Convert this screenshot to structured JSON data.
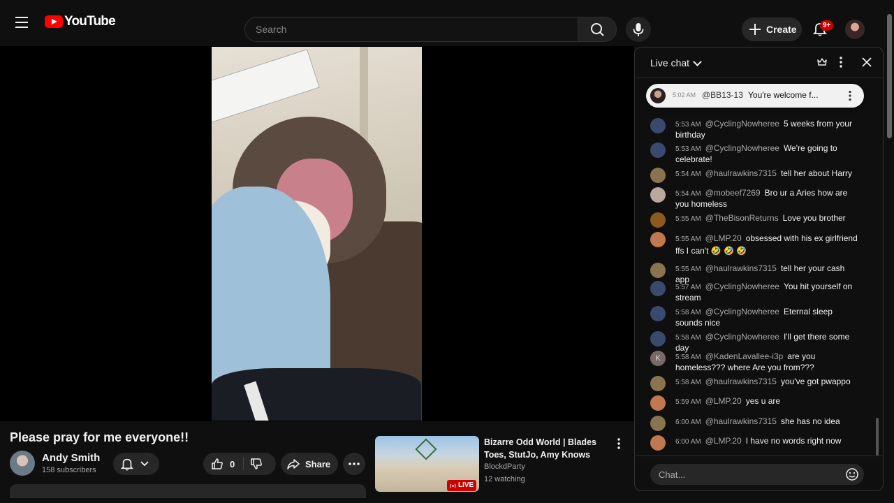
{
  "header": {
    "logo_text": "YouTube",
    "search_placeholder": "Search",
    "create_label": "Create",
    "notification_count": "9+"
  },
  "video": {
    "title": "Please pray for me everyone!!",
    "channel_name": "Andy Smith",
    "subscribers": "158 subscribers",
    "likes": "0",
    "share_label": "Share"
  },
  "suggested": {
    "title": "Bizarre Odd World | Blades Toes, StutJo, Amy Knows",
    "channel": "BlockdParty",
    "watching": "12 watching",
    "live_label": "LIVE"
  },
  "chat": {
    "title": "Live chat",
    "input_placeholder": "Chat...",
    "pinned": {
      "time": "5:02 AM",
      "author": "@BB13-13",
      "message": "You're welcome f..."
    },
    "messages": [
      {
        "time": "5:53 AM",
        "author": "@CyclingNowheree",
        "text": "5 weeks from your birthday",
        "avatar_color": "#3a4a6e"
      },
      {
        "time": "5:53 AM",
        "author": "@CyclingNowheree",
        "text": "We're going to celebrate!",
        "avatar_color": "#3a4a6e"
      },
      {
        "time": "5:54 AM",
        "author": "@haulrawkins7315",
        "text": "tell her about Harry",
        "avatar_color": "#8a7450"
      },
      {
        "time": "5:54 AM",
        "author": "@mobeef7269",
        "text": "Bro ur a Aries how are you homeless",
        "avatar_color": "#b9a8a0"
      },
      {
        "time": "5:55 AM",
        "author": "@TheBisonReturns",
        "text": "Love you brother",
        "avatar_color": "#8a5a20"
      },
      {
        "time": "5:55 AM",
        "author": "@LMP.20",
        "text": "obsessed with his ex girlfriend ffs I can't 🤣 🤣 🤣",
        "avatar_color": "#c07850"
      },
      {
        "time": "5:55 AM",
        "author": "@haulrawkins7315",
        "text": "tell her your cash app",
        "avatar_color": "#8a7450"
      },
      {
        "time": "5:57 AM",
        "author": "@CyclingNowheree",
        "text": "You hit yourself on stream",
        "avatar_color": "#3a4a6e"
      },
      {
        "time": "5:58 AM",
        "author": "@CyclingNowheree",
        "text": "Eternal sleep sounds nice",
        "avatar_color": "#3a4a6e"
      },
      {
        "time": "5:58 AM",
        "author": "@CyclingNowheree",
        "text": "I'll get there some day",
        "avatar_color": "#3a4a6e"
      },
      {
        "time": "5:58 AM",
        "author": "@KadenLavallee-i3p",
        "text": "are you homeless??? where Are you from???",
        "avatar_color": "#7a6a66",
        "avatar_letter": "K"
      },
      {
        "time": "5:58 AM",
        "author": "@haulrawkins7315",
        "text": "you've got pwappo",
        "avatar_color": "#8a7450"
      },
      {
        "time": "5:59 AM",
        "author": "@LMP.20",
        "text": "yes u are",
        "avatar_color": "#c07850"
      },
      {
        "time": "6:00 AM",
        "author": "@haulrawkins7315",
        "text": "she has no idea",
        "avatar_color": "#8a7450"
      },
      {
        "time": "6:00 AM",
        "author": "@LMP.20",
        "text": "I have no words right now",
        "avatar_color": "#c07850"
      }
    ]
  }
}
